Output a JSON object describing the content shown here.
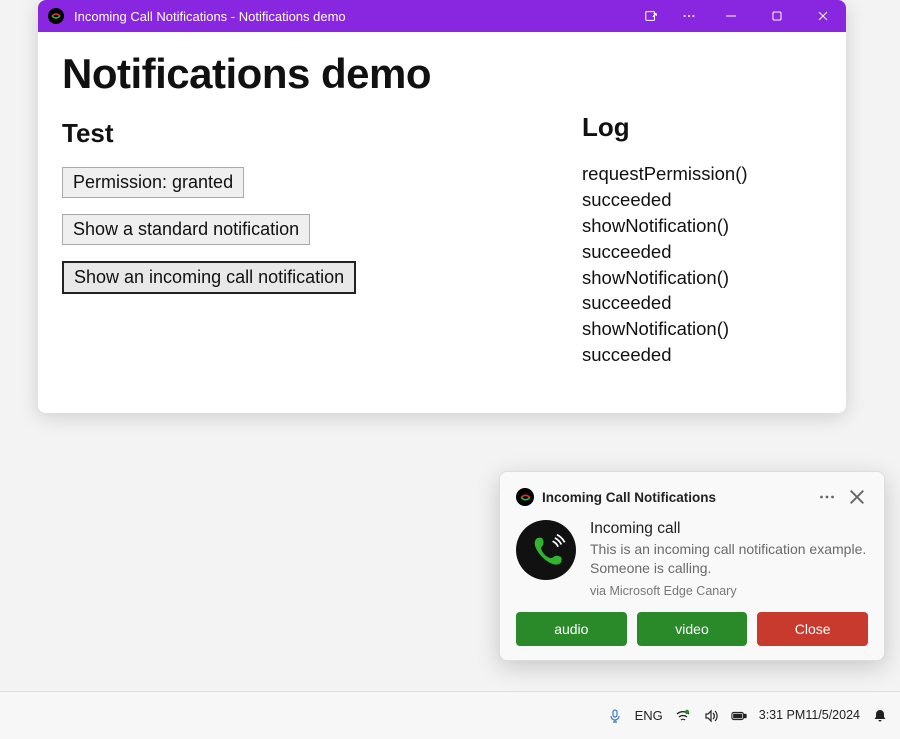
{
  "window": {
    "title": "Incoming Call Notifications - Notifications demo"
  },
  "page": {
    "heading": "Notifications demo",
    "test_heading": "Test",
    "log_heading": "Log",
    "permission_button": "Permission: granted",
    "standard_button": "Show a standard notification",
    "incoming_button": "Show an incoming call notification",
    "log_lines": [
      "requestPermission() succeeded",
      "showNotification() succeeded",
      "showNotification() succeeded",
      "showNotification() succeeded"
    ]
  },
  "toast": {
    "app_name": "Incoming Call Notifications",
    "title": "Incoming call",
    "body": "This is an incoming call notification example. Someone is calling.",
    "via": "via Microsoft Edge Canary",
    "actions": {
      "audio": "audio",
      "video": "video",
      "close": "Close"
    }
  },
  "taskbar": {
    "lang": "ENG",
    "time": "3:31 PM",
    "date": "11/5/2024"
  }
}
